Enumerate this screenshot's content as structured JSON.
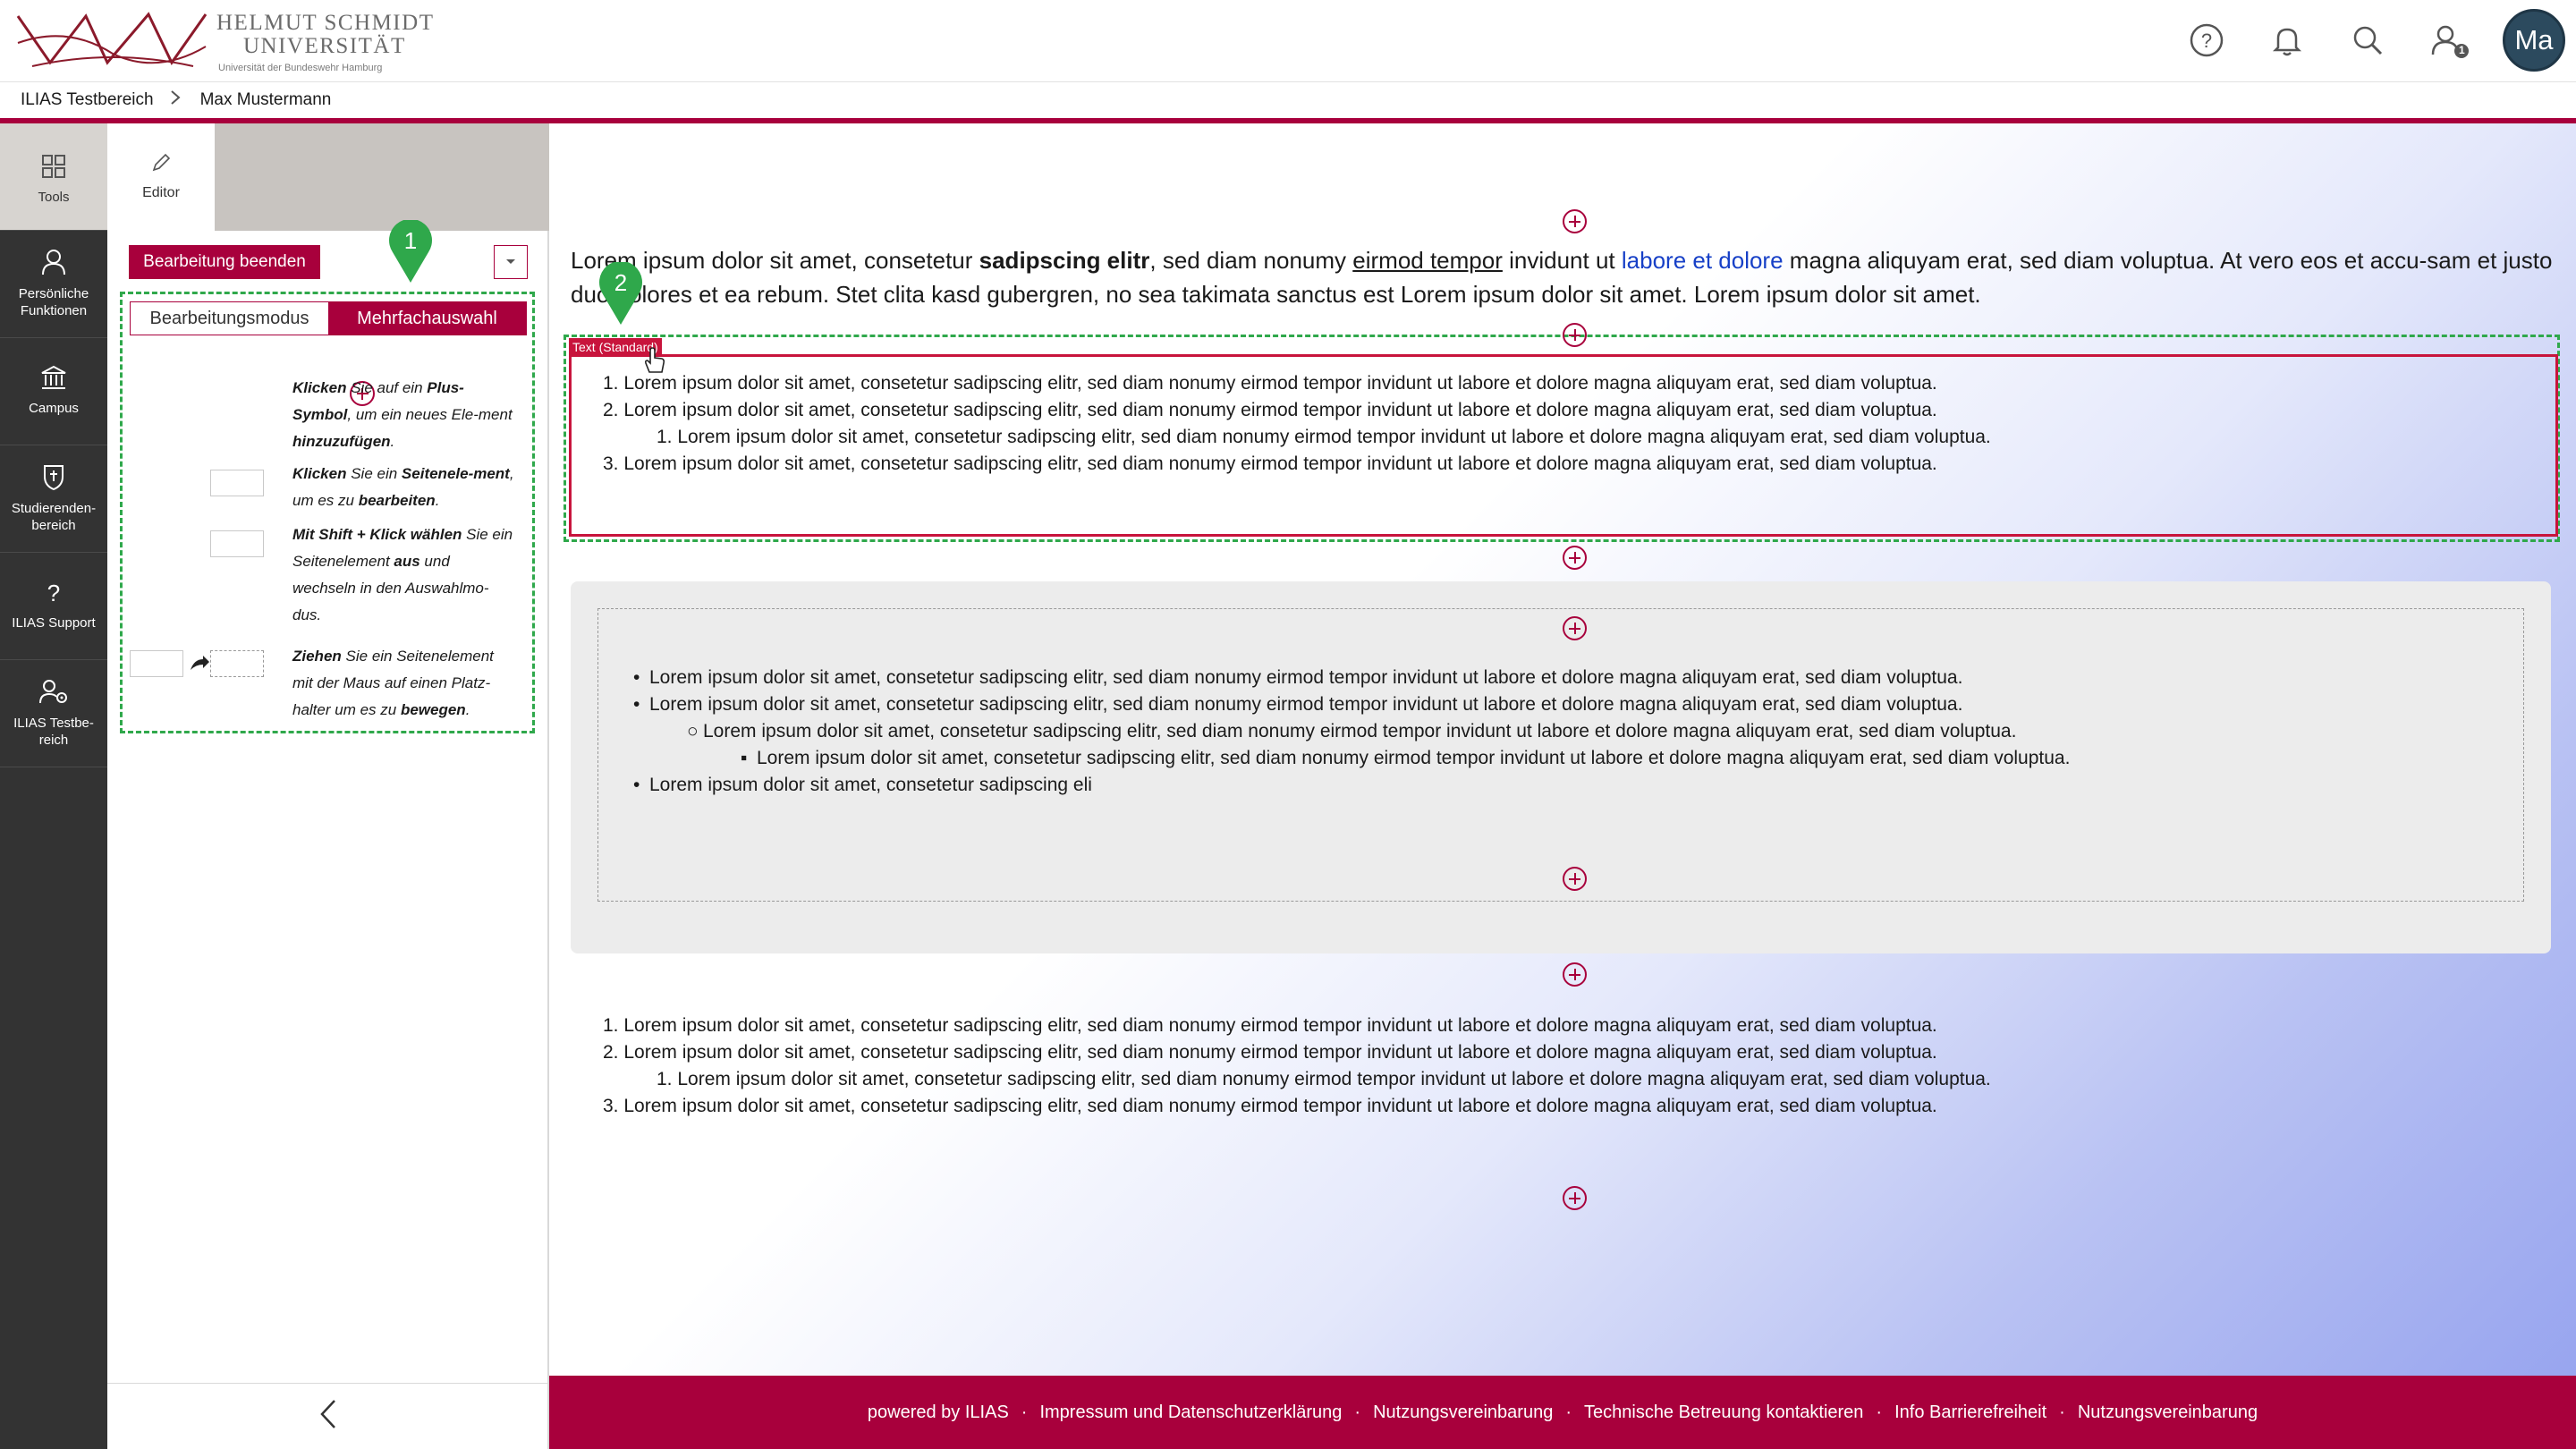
{
  "header": {
    "logo": {
      "line1": "HELMUT SCHMIDT",
      "line2": "UNIVERSITÄT",
      "line3": "Universität der Bundeswehr Hamburg"
    },
    "notification_badge": "1",
    "avatar_initials": "Ma"
  },
  "breadcrumb": {
    "items": [
      "ILIAS Testbereich",
      "Max Mustermann"
    ]
  },
  "mainbar": {
    "items": [
      {
        "label": "Tools",
        "icon": "grid-icon"
      },
      {
        "label": "Persönliche Funktionen",
        "icon": "user-icon"
      },
      {
        "label": "Campus",
        "icon": "bank-icon"
      },
      {
        "label": "Studierenden-bereich",
        "icon": "shield-icon"
      },
      {
        "label": "ILIAS Support",
        "icon": "question-icon"
      },
      {
        "label": "ILIAS Testbe-reich",
        "icon": "gear-user-icon"
      }
    ]
  },
  "slate": {
    "tab_editor": "Editor",
    "end_editing": "Bearbeitung beenden",
    "mode_edit": "Bearbeitungsmodus",
    "mode_multi": "Mehrfachauswahl",
    "help": [
      {
        "bold1": "Klicken",
        "t1": " Sie auf ein ",
        "bold2": "Plus-Symbol",
        "t2": ", um ein neues Ele-ment ",
        "bold3": "hinzuzufügen",
        "t3": "."
      },
      {
        "bold1": "Klicken",
        "t1": " Sie ein ",
        "bold2": "Seitenele-ment",
        "t2": ", um es zu ",
        "bold3": "bearbeiten",
        "t3": "."
      },
      {
        "bold1": "Mit ",
        "bold2": "Shift + Klick wählen",
        "t2": " Sie ein Seitenelement ",
        "bold3": "aus",
        "t3": " und wechseln in den Auswahlmo-dus."
      },
      {
        "bold1": "Ziehen",
        "t1": " Sie ein Seitenelement mit der Maus auf einen Platz-halter um es zu ",
        "bold3": "bewegen",
        "t3": "."
      }
    ]
  },
  "markers": {
    "m1": "1",
    "m2": "2"
  },
  "content": {
    "para1": {
      "a": "Lorem ipsum dolor sit amet, consetetur ",
      "b": "sadipscing elitr",
      "c": ", sed diam nonumy ",
      "d": "eirmod tempor",
      "e": " invidunt ut ",
      "f": "labore et dolore",
      "g": " magna aliquyam erat, sed diam voluptua. At vero eos et accu-sam et justo duo dolores et ea rebum. Stet clita kasd gubergren, no sea takimata sanctus est Lorem ipsum dolor sit amet. Lorem ipsum dolor sit amet."
    },
    "block_label": "Text (Standard)",
    "list1": [
      "1. Lorem ipsum dolor sit amet, consetetur sadipscing elitr, sed diam nonumy eirmod tempor invidunt ut labore et dolore magna aliquyam erat, sed diam voluptua.",
      "2. Lorem ipsum dolor sit amet, consetetur sadipscing elitr, sed diam nonumy eirmod tempor invidunt ut labore et dolore magna aliquyam erat, sed diam voluptua.",
      "1. Lorem ipsum dolor sit amet, consetetur sadipscing elitr, sed diam nonumy eirmod tempor invidunt ut labore et dolore magna aliquyam erat, sed diam voluptua.",
      "3. Lorem ipsum dolor sit amet, consetetur sadipscing elitr, sed diam nonumy eirmod tempor invidunt ut labore et dolore magna aliquyam erat, sed diam voluptua."
    ],
    "list2": [
      "Lorem ipsum dolor sit amet, consetetur sadipscing elitr, sed diam nonumy eirmod tempor invidunt ut labore et dolore magna aliquyam erat, sed diam voluptua.",
      "Lorem ipsum dolor sit amet, consetetur sadipscing elitr, sed diam nonumy eirmod tempor invidunt ut labore et dolore magna aliquyam erat, sed diam voluptua.",
      "Lorem ipsum dolor sit amet, consetetur sadipscing elitr, sed diam nonumy eirmod tempor invidunt ut labore et dolore magna aliquyam erat, sed diam voluptua.",
      "Lorem ipsum dolor sit amet, consetetur sadipscing elitr, sed diam nonumy eirmod tempor invidunt ut labore et dolore magna aliquyam erat, sed diam voluptua.",
      "Lorem ipsum dolor sit amet, consetetur sadipscing eli"
    ],
    "list3": [
      "1. Lorem ipsum dolor sit amet, consetetur sadipscing elitr, sed diam nonumy eirmod tempor invidunt ut labore et dolore magna aliquyam erat, sed diam voluptua.",
      "2. Lorem ipsum dolor sit amet, consetetur sadipscing elitr, sed diam nonumy eirmod tempor invidunt ut labore et dolore magna aliquyam erat, sed diam voluptua.",
      "1. Lorem ipsum dolor sit amet, consetetur sadipscing elitr, sed diam nonumy eirmod tempor invidunt ut labore et dolore magna aliquyam erat, sed diam voluptua.",
      "3. Lorem ipsum dolor sit amet, consetetur sadipscing elitr, sed diam nonumy eirmod tempor invidunt ut labore et dolore magna aliquyam erat, sed diam voluptua."
    ]
  },
  "footer": {
    "links": [
      "powered by ILIAS",
      "Impressum und Datenschutzerklärung",
      "Nutzungsvereinbarung",
      "Technische Betreuung kontaktieren",
      "Info Barrierefreiheit",
      "Nutzungsvereinbarung"
    ]
  },
  "colors": {
    "brand": "#a8003c",
    "marker": "#2fa84b",
    "sidebar": "#333333"
  }
}
